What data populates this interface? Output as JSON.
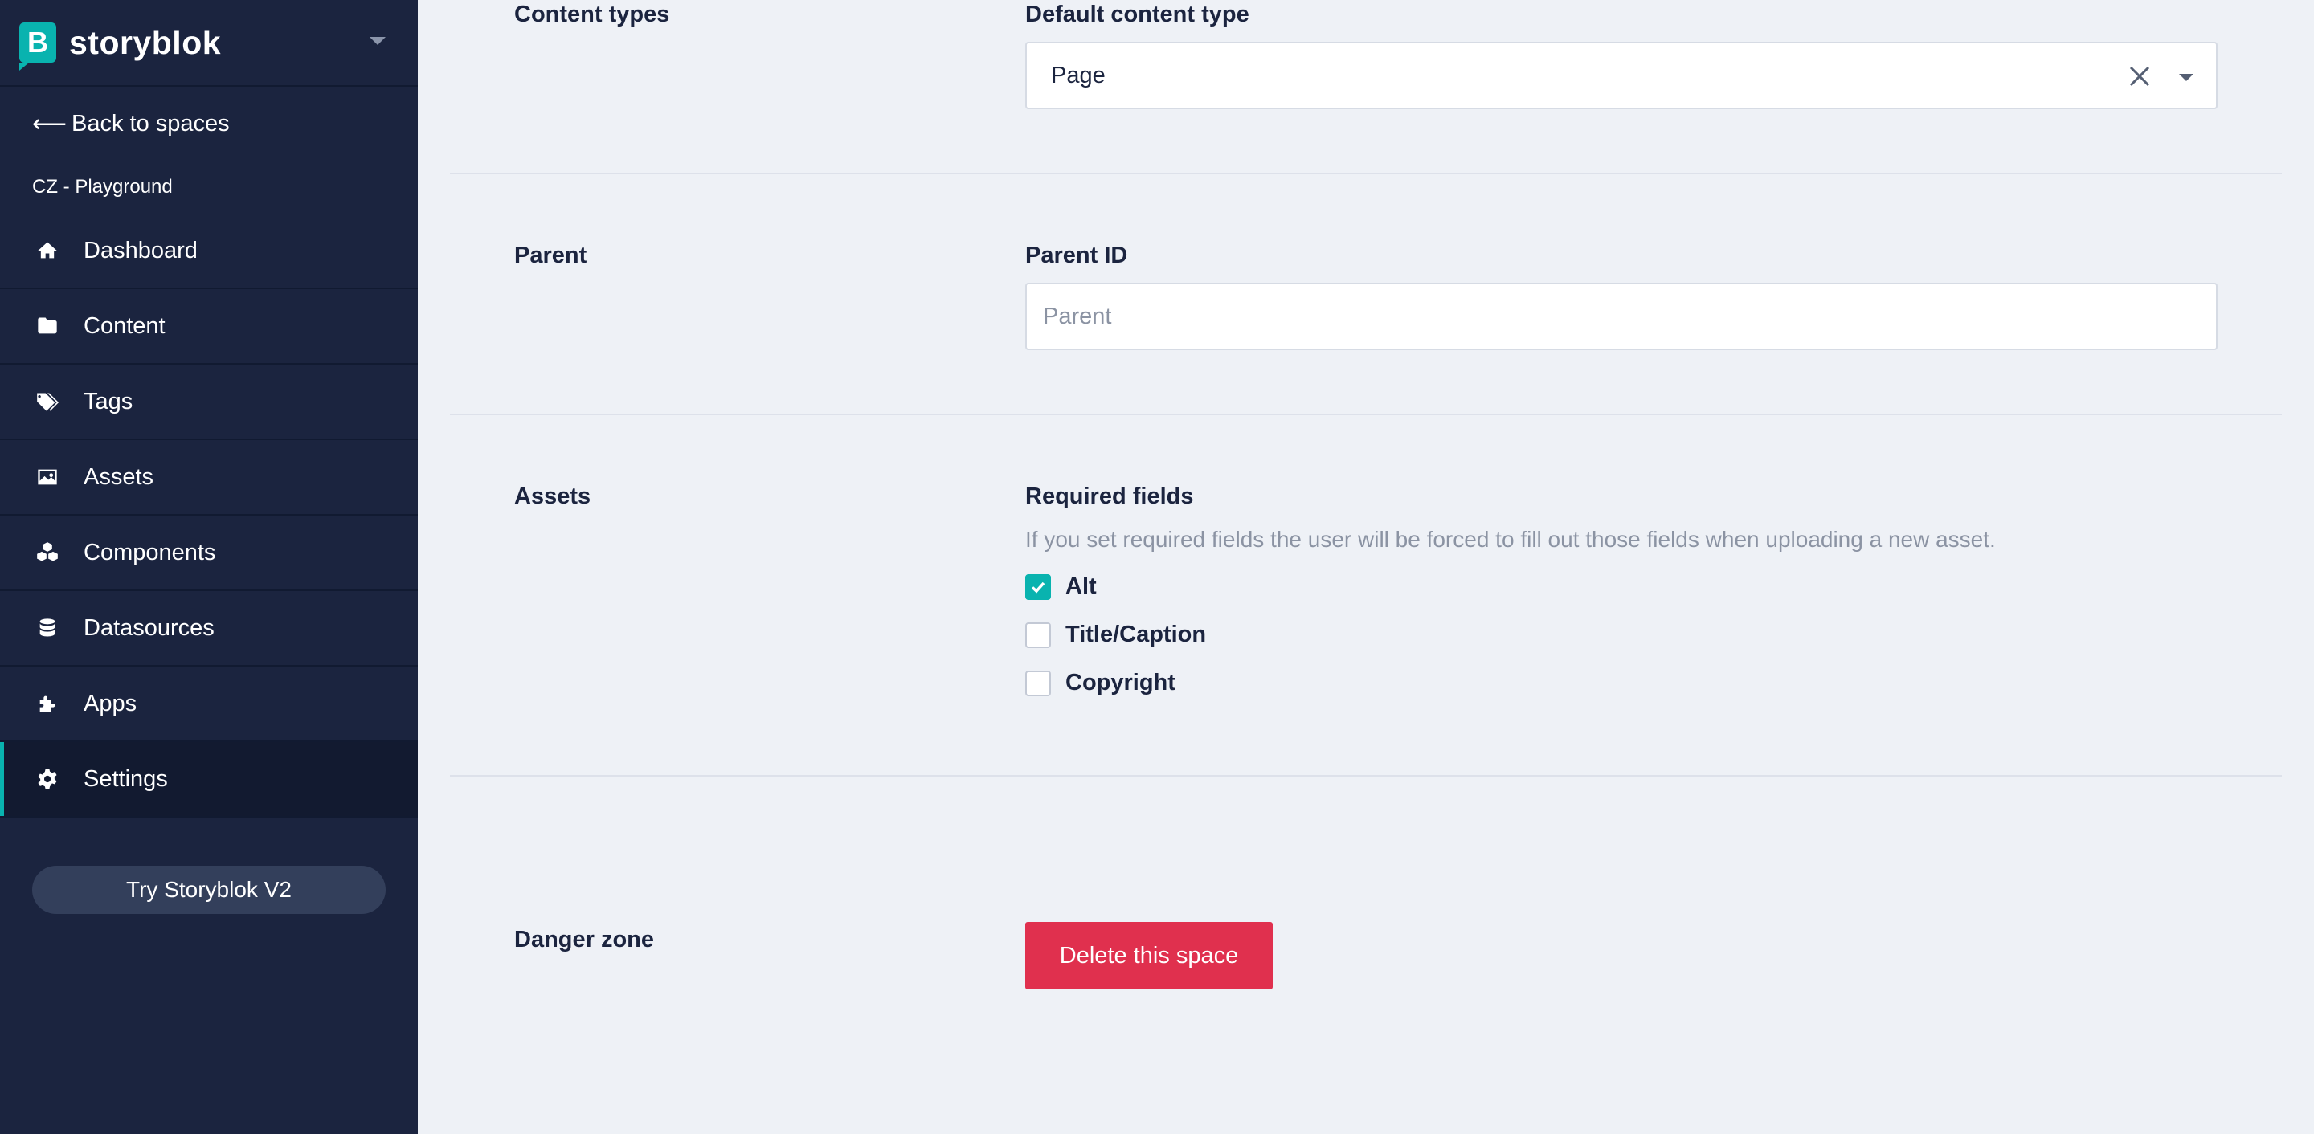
{
  "brand": {
    "name": "storyblok",
    "logo_letter": "B",
    "accent_color": "#09b3af"
  },
  "sidebar": {
    "back_label": "Back to spaces",
    "space_name": "CZ - Playground",
    "items": [
      {
        "label": "Dashboard",
        "icon": "home-icon"
      },
      {
        "label": "Content",
        "icon": "folder-icon"
      },
      {
        "label": "Tags",
        "icon": "tags-icon"
      },
      {
        "label": "Assets",
        "icon": "image-icon"
      },
      {
        "label": "Components",
        "icon": "cubes-icon"
      },
      {
        "label": "Datasources",
        "icon": "database-icon"
      },
      {
        "label": "Apps",
        "icon": "puzzle-icon"
      },
      {
        "label": "Settings",
        "icon": "gear-icon",
        "active": true
      }
    ],
    "try_v2_label": "Try Storyblok V2"
  },
  "content_types": {
    "section_label": "Content types",
    "field_label": "Default content type",
    "value": "Page"
  },
  "parent": {
    "section_label": "Parent",
    "field_label": "Parent ID",
    "placeholder": "Parent"
  },
  "assets": {
    "section_label": "Assets",
    "field_label": "Required fields",
    "hint": "If you set required fields the user will be forced to fill out those fields when uploading a new asset.",
    "options": [
      {
        "label": "Alt",
        "checked": true
      },
      {
        "label": "Title/Caption",
        "checked": false
      },
      {
        "label": "Copyright",
        "checked": false
      }
    ]
  },
  "danger_zone": {
    "section_label": "Danger zone",
    "delete_label": "Delete this space",
    "danger_color": "#e0304e"
  }
}
